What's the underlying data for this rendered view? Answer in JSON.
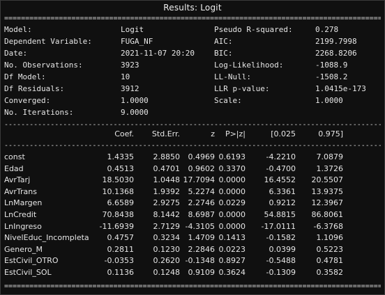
{
  "title": "Results: Logit",
  "summary_rows": [
    {
      "l_label": "Model:",
      "l_value": "Logit",
      "r_label": "Pseudo R-squared:",
      "r_value": "0.278"
    },
    {
      "l_label": "Dependent Variable:",
      "l_value": "FUGA_NF",
      "r_label": "AIC:",
      "r_value": "2199.7998"
    },
    {
      "l_label": "Date:",
      "l_value": "2021-11-07 20:20",
      "r_label": "BIC:",
      "r_value": "2268.8206"
    },
    {
      "l_label": "No. Observations:",
      "l_value": "3923",
      "r_label": "Log-Likelihood:",
      "r_value": "-1088.9"
    },
    {
      "l_label": "Df Model:",
      "l_value": "10",
      "r_label": "LL-Null:",
      "r_value": "-1508.2"
    },
    {
      "l_label": "Df Residuals:",
      "l_value": "3912",
      "r_label": "LLR p-value:",
      "r_value": "1.0415e-173"
    },
    {
      "l_label": "Converged:",
      "l_value": "1.0000",
      "r_label": "Scale:",
      "r_value": "1.0000"
    },
    {
      "l_label": "No. Iterations:",
      "l_value": "9.0000",
      "r_label": "",
      "r_value": ""
    }
  ],
  "columns": [
    "Coef.",
    "Std.Err.",
    "z",
    "P>|z|",
    "[0.025",
    "0.975]"
  ],
  "coefficients": [
    {
      "name": "const",
      "coef": "1.4335",
      "se": "2.8850",
      "z": "0.4969",
      "p": "0.6193",
      "lo": "-4.2210",
      "hi": "7.0879"
    },
    {
      "name": "Edad",
      "coef": "0.4513",
      "se": "0.4701",
      "z": "0.9602",
      "p": "0.3370",
      "lo": "-0.4700",
      "hi": "1.3726"
    },
    {
      "name": "AvrTarj",
      "coef": "18.5030",
      "se": "1.0448",
      "z": "17.7094",
      "p": "0.0000",
      "lo": "16.4552",
      "hi": "20.5507"
    },
    {
      "name": "AvrTrans",
      "coef": "10.1368",
      "se": "1.9392",
      "z": "5.2274",
      "p": "0.0000",
      "lo": "6.3361",
      "hi": "13.9375"
    },
    {
      "name": "LnMargen",
      "coef": "6.6589",
      "se": "2.9275",
      "z": "2.2746",
      "p": "0.0229",
      "lo": "0.9212",
      "hi": "12.3967"
    },
    {
      "name": "LnCredit",
      "coef": "70.8438",
      "se": "8.1442",
      "z": "8.6987",
      "p": "0.0000",
      "lo": "54.8815",
      "hi": "86.8061"
    },
    {
      "name": "LnIngreso",
      "coef": "-11.6939",
      "se": "2.7129",
      "z": "-4.3105",
      "p": "0.0000",
      "lo": "-17.0111",
      "hi": "-6.3768"
    },
    {
      "name": "NivelEduc_Incompleta",
      "coef": "0.4757",
      "se": "0.3234",
      "z": "1.4709",
      "p": "0.1413",
      "lo": "-0.1582",
      "hi": "1.1096"
    },
    {
      "name": "Genero_M",
      "coef": "0.2811",
      "se": "0.1230",
      "z": "2.2846",
      "p": "0.0223",
      "lo": "0.0399",
      "hi": "0.5223"
    },
    {
      "name": "EstCivil_OTRO",
      "coef": "-0.0353",
      "se": "0.2620",
      "z": "-0.1348",
      "p": "0.8927",
      "lo": "-0.5488",
      "hi": "0.4781"
    },
    {
      "name": "EstCivil_SOL",
      "coef": "0.1136",
      "se": "0.1248",
      "z": "0.9109",
      "p": "0.3624",
      "lo": "-0.1309",
      "hi": "0.3582"
    }
  ]
}
